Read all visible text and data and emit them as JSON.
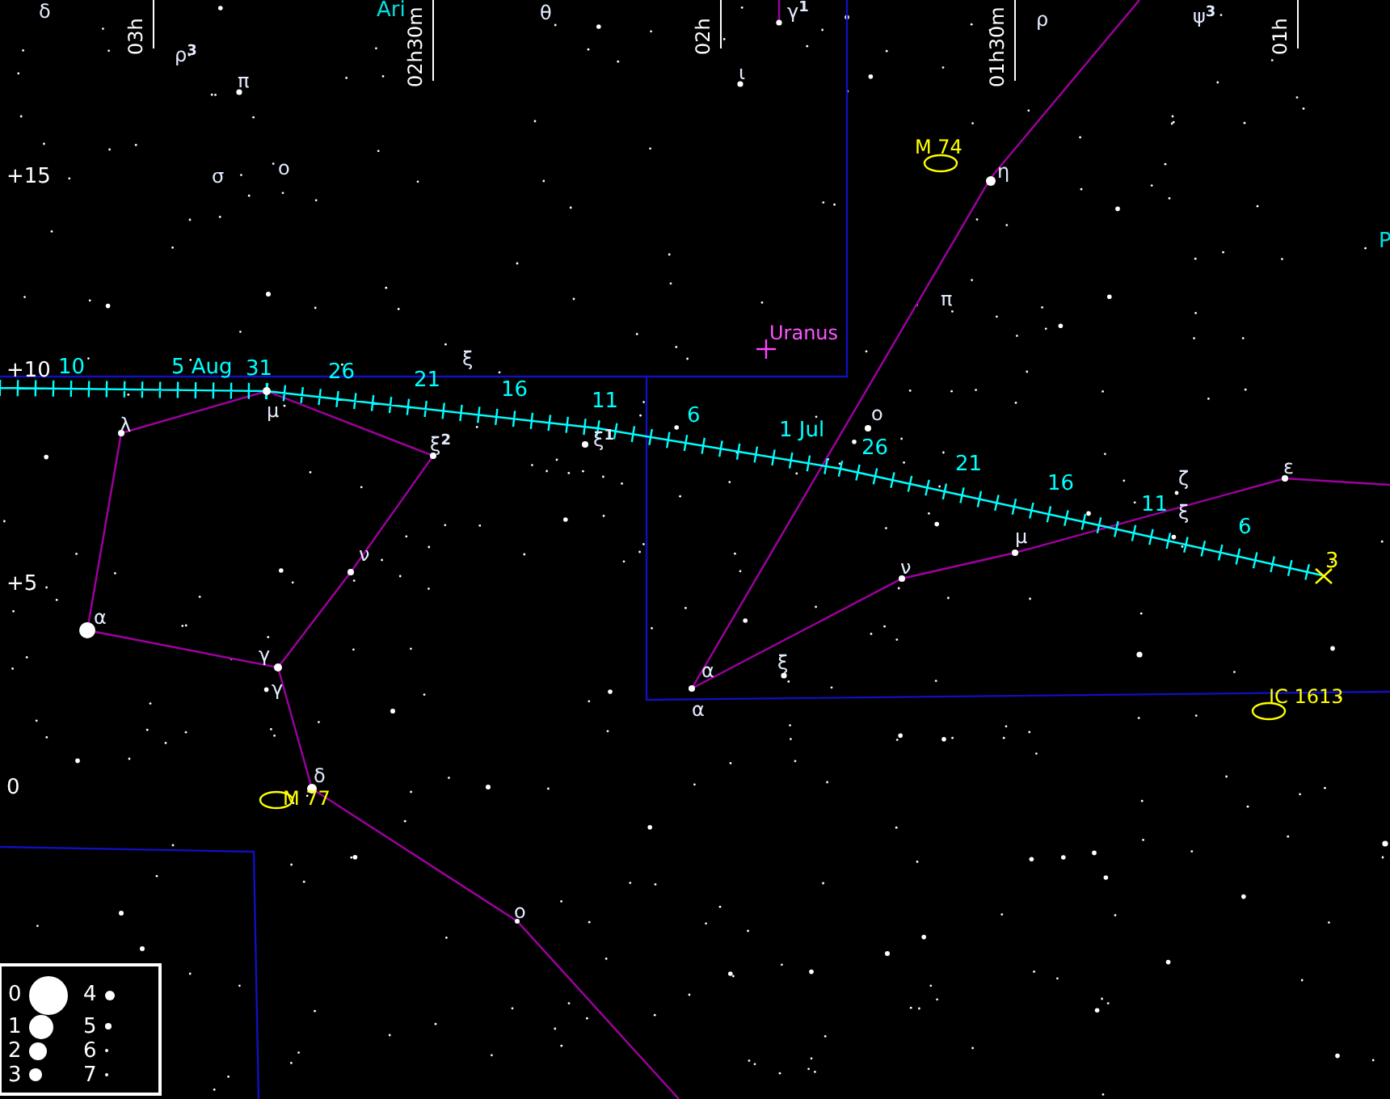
{
  "ra_labels": [
    "03h",
    "02h30m",
    "02h",
    "01h30m",
    "01h"
  ],
  "dec_labels": [
    "+15",
    "+10",
    "+5",
    "0"
  ],
  "constellation_labels": [
    "Ari",
    "P"
  ],
  "star_labels": [
    "δ",
    "ρ$^{3}$",
    "π",
    "σ",
    "ο",
    "θ",
    "γ$^{1}$",
    "ι",
    "ρ",
    "ψ$^{3}$",
    "η",
    "π",
    "ξ",
    "μ",
    "λ",
    "ξ$^{2}$",
    "ξ$^{1}$",
    "ν",
    "α",
    "γ",
    "γ",
    "δ",
    "ο",
    "ο",
    "ν",
    "μ",
    "ζ",
    "ξ",
    "ε",
    "α",
    "α",
    "ξ"
  ],
  "planet": {
    "name": "Uranus"
  },
  "track": {
    "labels": [
      "10",
      "5 Aug",
      "31",
      "26",
      "21",
      "16",
      "11",
      "6",
      "1 Jul",
      "26",
      "21",
      "16",
      "11",
      "6"
    ],
    "end_label": "3"
  },
  "deep_sky": [
    "M 74",
    "M 77",
    "IC 1613"
  ],
  "legend": [
    "0",
    "1",
    "2",
    "3",
    "4",
    "5",
    "6",
    "7"
  ]
}
